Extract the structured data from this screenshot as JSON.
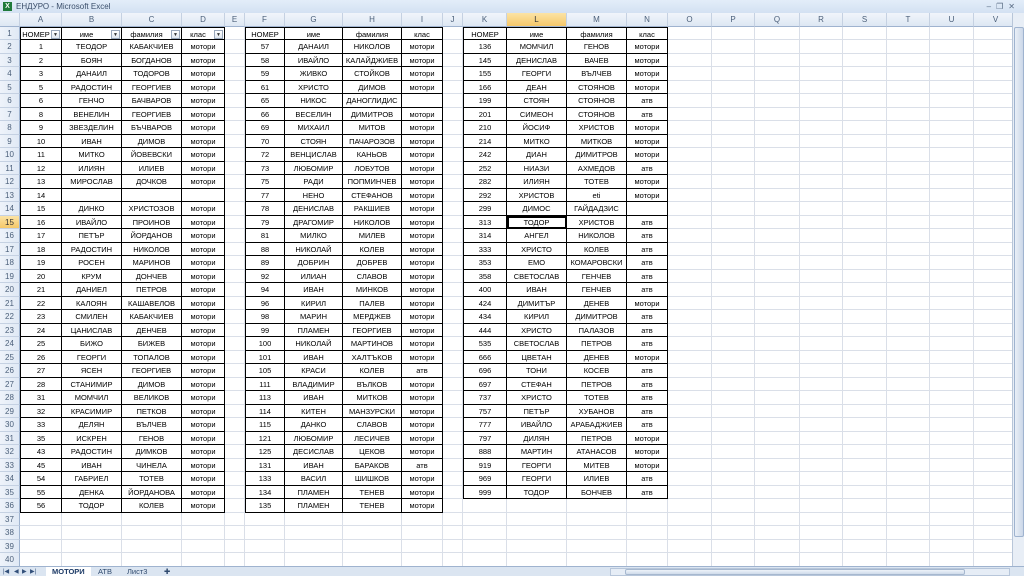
{
  "window": {
    "title": "ЕНДУРО - Microsoft Excel",
    "app_icon": "excel-icon",
    "controls": [
      "minimize",
      "restore",
      "close"
    ]
  },
  "columns": [
    "A",
    "B",
    "C",
    "D",
    "E",
    "F",
    "G",
    "H",
    "I",
    "J",
    "K",
    "L",
    "M",
    "N",
    "O",
    "P",
    "Q",
    "R",
    "S",
    "T",
    "U",
    "V"
  ],
  "row_count": 40,
  "selected_cell": "L15",
  "colors": {
    "header_bg": "#e4ecf7",
    "selected_header": "#f8d88a",
    "grid": "#dadfe8",
    "border": "#000000"
  },
  "tables": [
    {
      "start_col": "A",
      "headers": [
        "НОМЕР",
        "име",
        "фамилия",
        "клас"
      ],
      "filters": true,
      "rows": [
        [
          "1",
          "ТЕОДОР",
          "КАБАКЧИЕВ",
          "мотори"
        ],
        [
          "2",
          "БОЯН",
          "БОГДАНОВ",
          "мотори"
        ],
        [
          "3",
          "ДАНАИЛ",
          "ТОДОРОВ",
          "мотори"
        ],
        [
          "5",
          "РАДОСТИН",
          "ГЕОРГИЕВ",
          "мотори"
        ],
        [
          "6",
          "ГЕНЧО",
          "БАЧВАРОВ",
          "мотори"
        ],
        [
          "8",
          "ВЕНЕЛИН",
          "ГЕОРГИЕВ",
          "мотори"
        ],
        [
          "9",
          "ЗВЕЗДЕЛИН",
          "БЪЧВАРОВ",
          "мотори"
        ],
        [
          "10",
          "ИВАН",
          "ДИМОВ",
          "мотори"
        ],
        [
          "11",
          "МИТКО",
          "ЙОВЕВСКИ",
          "мотори"
        ],
        [
          "12",
          "ИЛИЯН",
          "ИЛИЕВ",
          "мотори"
        ],
        [
          "13",
          "МИРОСЛАВ",
          "ДОЧКОВ",
          "мотори"
        ],
        [
          "14",
          "",
          "",
          ""
        ],
        [
          "15",
          "ДИНКО",
          "ХРИСТОЗОВ",
          "мотори"
        ],
        [
          "16",
          "ИВАЙЛО",
          "ПРОИНОВ",
          "мотори"
        ],
        [
          "17",
          "ПЕТЪР",
          "ЙОРДАНОВ",
          "мотори"
        ],
        [
          "18",
          "РАДОСТИН",
          "НИКОЛОВ",
          "мотори"
        ],
        [
          "19",
          "РОСЕН",
          "МАРИНОВ",
          "мотори"
        ],
        [
          "20",
          "КРУМ",
          "ДОНЧЕВ",
          "мотори"
        ],
        [
          "21",
          "ДАНИЕЛ",
          "ПЕТРОВ",
          "мотори"
        ],
        [
          "22",
          "КАЛОЯН",
          "КАШАВЕЛОВ",
          "мотори"
        ],
        [
          "23",
          "СМИЛЕН",
          "КАБАКЧИЕВ",
          "мотори"
        ],
        [
          "24",
          "ЦАНИСЛАВ",
          "ДЕНЧЕВ",
          "мотори"
        ],
        [
          "25",
          "БИЖО",
          "БИЖЕВ",
          "мотори"
        ],
        [
          "26",
          "ГЕОРГИ",
          "ТОПАЛОВ",
          "мотори"
        ],
        [
          "27",
          "ЯСЕН",
          "ГЕОРГИЕВ",
          "мотори"
        ],
        [
          "28",
          "СТАНИМИР",
          "ДИМОВ",
          "мотори"
        ],
        [
          "31",
          "МОМЧИЛ",
          "ВЕЛИКОВ",
          "мотори"
        ],
        [
          "32",
          "КРАСИМИР",
          "ПЕТКОВ",
          "мотори"
        ],
        [
          "33",
          "ДЕЛЯН",
          "ВЪЛЧЕВ",
          "мотори"
        ],
        [
          "35",
          "ИСКРЕН",
          "ГЕНОВ",
          "мотори"
        ],
        [
          "43",
          "РАДОСТИН",
          "ДИМКОВ",
          "мотори"
        ],
        [
          "45",
          "ИВАН",
          "ЧИНЕЛА",
          "мотори"
        ],
        [
          "54",
          "ГАБРИЕЛ",
          "ТОТЕВ",
          "мотори"
        ],
        [
          "55",
          "ДЕНКА",
          "ЙОРДАНОВА",
          "мотори"
        ],
        [
          "56",
          "ТОДОР",
          "КОЛЕВ",
          "мотори"
        ]
      ]
    },
    {
      "start_col": "F",
      "headers": [
        "НОМЕР",
        "име",
        "фамилия",
        "клас"
      ],
      "filters": false,
      "rows": [
        [
          "57",
          "ДАНАИЛ",
          "НИКОЛОВ",
          "мотори"
        ],
        [
          "58",
          "ИВАЙЛО",
          "КАЛАЙДЖИЕВ",
          "мотори"
        ],
        [
          "59",
          "ЖИВКО",
          "СТОЙКОВ",
          "мотори"
        ],
        [
          "61",
          "ХРИСТО",
          "ДИМОВ",
          "мотори"
        ],
        [
          "65",
          "НИКОС",
          "ДАНОГЛИДИС",
          ""
        ],
        [
          "66",
          "ВЕСЕЛИН",
          "ДИМИТРОВ",
          "мотори"
        ],
        [
          "69",
          "МИХАИЛ",
          "МИТОВ",
          "мотори"
        ],
        [
          "70",
          "СТОЯН",
          "ПАЧАРОЗОВ",
          "мотори"
        ],
        [
          "72",
          "ВЕНЦИСЛАВ",
          "КАНЬОВ",
          "мотори"
        ],
        [
          "73",
          "ЛЮБОМИР",
          "ЛОБУТОВ",
          "мотори"
        ],
        [
          "75",
          "РАДИ",
          "ПОПМИНЧЕВ",
          "мотори"
        ],
        [
          "77",
          "НЕНО",
          "СТЕФАНОВ",
          "мотори"
        ],
        [
          "78",
          "ДЕНИСЛАВ",
          "РАКШИЕВ",
          "мотори"
        ],
        [
          "79",
          "ДРАГОМИР",
          "НИКОЛОВ",
          "мотори"
        ],
        [
          "81",
          "МИЛКО",
          "МИЛЕВ",
          "мотори"
        ],
        [
          "88",
          "НИКОЛАЙ",
          "КОЛЕВ",
          "мотори"
        ],
        [
          "89",
          "ДОБРИН",
          "ДОБРЕВ",
          "мотори"
        ],
        [
          "92",
          "ИЛИАН",
          "СЛАВОВ",
          "мотори"
        ],
        [
          "94",
          "ИВАН",
          "МИНКОВ",
          "мотори"
        ],
        [
          "96",
          "КИРИЛ",
          "ПАЛЕВ",
          "мотори"
        ],
        [
          "98",
          "МАРИН",
          "МЕРДЖЕВ",
          "мотори"
        ],
        [
          "99",
          "ПЛАМЕН",
          "ГЕОРГИЕВ",
          "мотори"
        ],
        [
          "100",
          "НИКОЛАЙ",
          "МАРТИНОВ",
          "мотори"
        ],
        [
          "101",
          "ИВАН",
          "ХАЛТЪКОВ",
          "мотори"
        ],
        [
          "105",
          "КРАСИ",
          "КОЛЕВ",
          "атв"
        ],
        [
          "111",
          "ВЛАДИМИР",
          "ВЪЛКОВ",
          "мотори"
        ],
        [
          "113",
          "ИВАН",
          "МИТКОВ",
          "мотори"
        ],
        [
          "114",
          "КИТЕН",
          "МАНЗУРСКИ",
          "мотори"
        ],
        [
          "115",
          "ДАНКО",
          "СЛАВОВ",
          "мотори"
        ],
        [
          "121",
          "ЛЮБОМИР",
          "ЛЕСИЧЕВ",
          "мотори"
        ],
        [
          "125",
          "ДЕСИСЛАВ",
          "ЦЕКОВ",
          "мотори"
        ],
        [
          "131",
          "ИВАН",
          "БАРАКОВ",
          "атв"
        ],
        [
          "133",
          "ВАСИЛ",
          "ШИШКОВ",
          "мотори"
        ],
        [
          "134",
          "ПЛАМЕН",
          "ТЕНЕВ",
          "мотори"
        ],
        [
          "135",
          "ПЛАМЕН",
          "ТЕНЕВ",
          "мотори"
        ]
      ]
    },
    {
      "start_col": "K",
      "headers": [
        "НОМЕР",
        "име",
        "фамилия",
        "клас"
      ],
      "filters": false,
      "rows": [
        [
          "136",
          "МОМЧИЛ",
          "ГЕНОВ",
          "мотори"
        ],
        [
          "145",
          "ДЕНИСЛАВ",
          "ВАЧЕВ",
          "мотори"
        ],
        [
          "155",
          "ГЕОРГИ",
          "ВЪЛЧЕВ",
          "мотори"
        ],
        [
          "166",
          "ДЕАН",
          "СТОЯНОВ",
          "мотори"
        ],
        [
          "199",
          "СТОЯН",
          "СТОЯНОВ",
          "атв"
        ],
        [
          "201",
          "СИМЕОН",
          "СТОЯНОВ",
          "атв"
        ],
        [
          "210",
          "ЙОСИФ",
          "ХРИСТОВ",
          "мотори"
        ],
        [
          "214",
          "МИТКО",
          "МИТКОВ",
          "мотори"
        ],
        [
          "242",
          "ДИАН",
          "ДИМИТРОВ",
          "мотори"
        ],
        [
          "252",
          "НИАЗИ",
          "АХМЕДОВ",
          "атв"
        ],
        [
          "282",
          "ИЛИЯН",
          "ТОТЕВ",
          "мотори"
        ],
        [
          "292",
          "ХРИСТОВ",
          "eti",
          "мотори"
        ],
        [
          "299",
          "ДИМОС",
          "ГАЙДАДЗИС",
          ""
        ],
        [
          "313",
          "ТОДОР",
          "ХРИСТОВ",
          "атв"
        ],
        [
          "314",
          "АНГЕЛ",
          "НИКОЛОВ",
          "атв"
        ],
        [
          "333",
          "ХРИСТО",
          "КОЛЕВ",
          "атв"
        ],
        [
          "353",
          "ЕМО",
          "КОМАРОВСКИ",
          "атв"
        ],
        [
          "358",
          "СВЕТОСЛАВ",
          "ГЕНЧЕВ",
          "атв"
        ],
        [
          "400",
          "ИВАН",
          "ГЕНЧЕВ",
          "атв"
        ],
        [
          "424",
          "ДИМИТЪР",
          "ДЕНЕВ",
          "мотори"
        ],
        [
          "434",
          "КИРИЛ",
          "ДИМИТРОВ",
          "атв"
        ],
        [
          "444",
          "ХРИСТО",
          "ПАЛАЗОВ",
          "атв"
        ],
        [
          "535",
          "СВЕТОСЛАВ",
          "ПЕТРОВ",
          "атв"
        ],
        [
          "666",
          "ЦВЕТАН",
          "ДЕНЕВ",
          "мотори"
        ],
        [
          "696",
          "ТОНИ",
          "КОСЕВ",
          "атв"
        ],
        [
          "697",
          "СТЕФАН",
          "ПЕТРОВ",
          "атв"
        ],
        [
          "737",
          "ХРИСТО",
          "ТОТЕВ",
          "атв"
        ],
        [
          "757",
          "ПЕТЪР",
          "ХУБАНОВ",
          "атв"
        ],
        [
          "777",
          "ИВАЙЛО",
          "АРАБАДЖИЕВ",
          "атв"
        ],
        [
          "797",
          "ДИЛЯН",
          "ПЕТРОВ",
          "мотори"
        ],
        [
          "888",
          "МАРТИН",
          "АТАНАСОВ",
          "мотори"
        ],
        [
          "919",
          "ГЕОРГИ",
          "МИТЕВ",
          "мотори"
        ],
        [
          "969",
          "ГЕОРГИ",
          "ИЛИЕВ",
          "атв"
        ],
        [
          "999",
          "ТОДОР",
          "БОНЧЕВ",
          "атв"
        ]
      ]
    }
  ],
  "sheet_tabs": [
    {
      "label": "МОТОРИ",
      "active": true
    },
    {
      "label": "АТВ",
      "active": false
    },
    {
      "label": "Лист3",
      "active": false
    }
  ]
}
